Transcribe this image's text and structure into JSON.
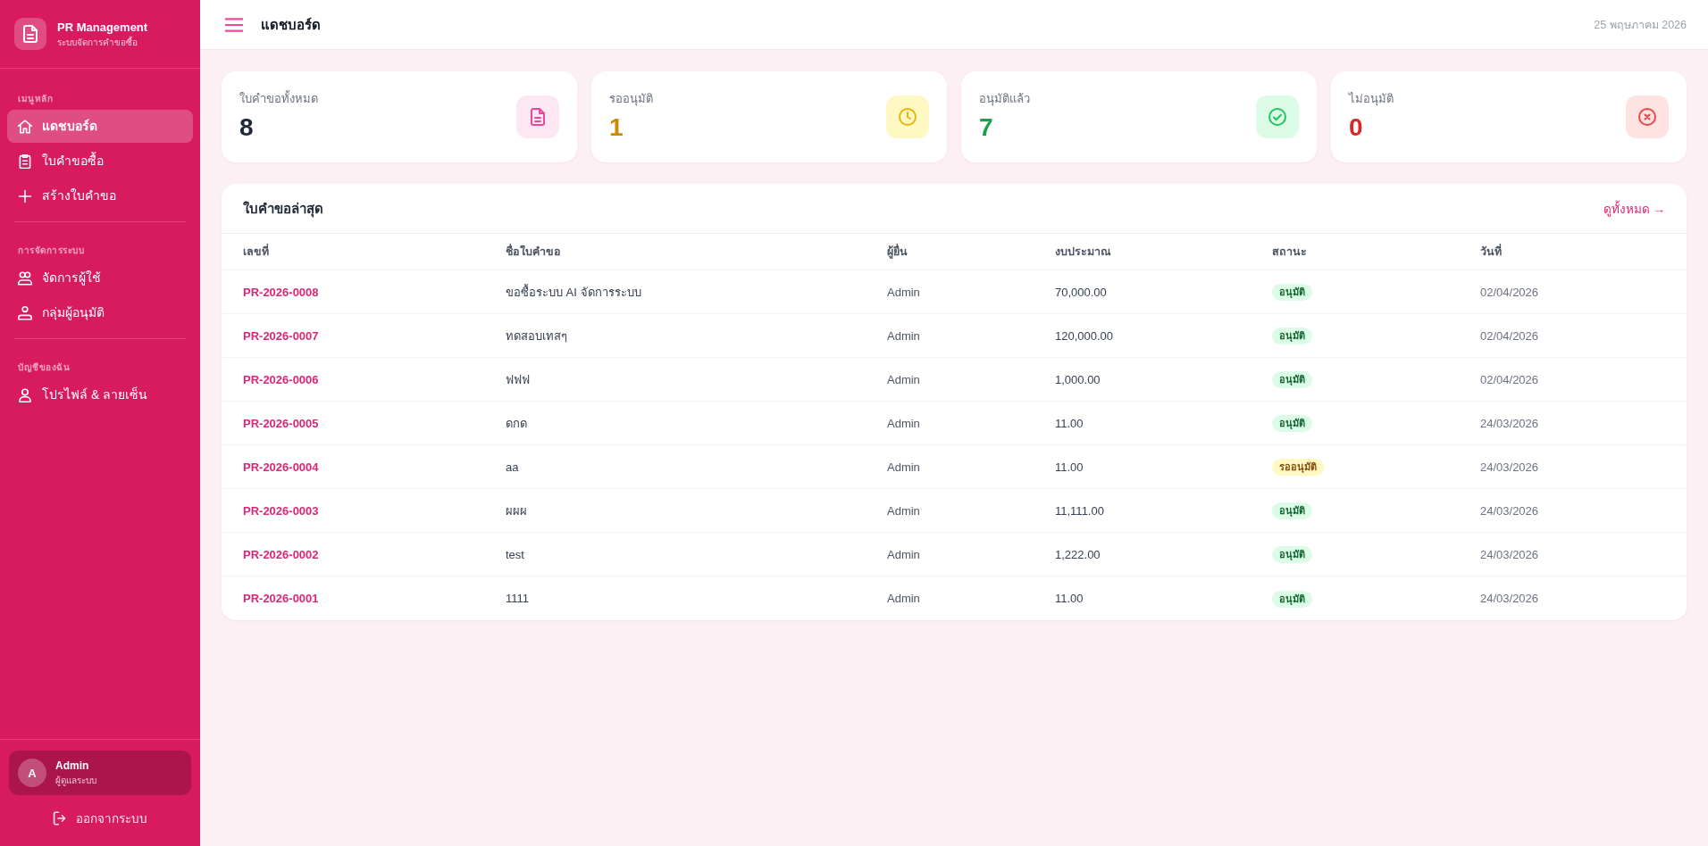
{
  "sidebar": {
    "brand": {
      "title": "PR Management",
      "subtitle": "ระบบจัดการคำขอซื้อ"
    },
    "sections": [
      {
        "label": "เมนูหลัก",
        "items": [
          {
            "label": "แดชบอร์ด",
            "selected": true
          },
          {
            "label": "ใบคำขอซื้อ",
            "selected": false
          },
          {
            "label": "สร้างใบคำขอ",
            "selected": false
          }
        ]
      },
      {
        "label": "การจัดการระบบ",
        "items": [
          {
            "label": "จัดการผู้ใช้",
            "selected": false
          },
          {
            "label": "กลุ่มผู้อนุมัติ",
            "selected": false
          }
        ]
      },
      {
        "label": "บัญชีของฉัน",
        "items": [
          {
            "label": "โปรไฟล์ & ลายเซ็น",
            "selected": false
          }
        ]
      }
    ],
    "user": {
      "initial": "A",
      "name": "Admin",
      "role": "ผู้ดูแลระบบ"
    },
    "logout": "ออกจากระบบ"
  },
  "header": {
    "title": "แดชบอร์ด",
    "date": "25 พฤษภาคม 2026"
  },
  "stats": [
    {
      "kind": "total",
      "label": "ใบคำขอทั้งหมด",
      "value": "8"
    },
    {
      "kind": "pending",
      "label": "รออนุมัติ",
      "value": "1"
    },
    {
      "kind": "approved",
      "label": "อนุมัติแล้ว",
      "value": "7"
    },
    {
      "kind": "rejected",
      "label": "ไม่อนุมัติ",
      "value": "0"
    }
  ],
  "recent": {
    "title": "ใบคำขอล่าสุด",
    "view_all": "ดูทั้งหมด →",
    "columns": [
      "เลขที่",
      "ชื่อใบคำขอ",
      "ผู้ยื่น",
      "งบประมาณ",
      "สถานะ",
      "วันที่"
    ],
    "rows": [
      {
        "number": "PR-2026-0008",
        "title": "ขอซื้อระบบ AI จัดการระบบ",
        "requester": "Admin",
        "budget": "70,000.00",
        "status": {
          "label": "อนุมัติ",
          "kind": "approved"
        },
        "date": "02/04/2026"
      },
      {
        "number": "PR-2026-0007",
        "title": "ทดสอบเทสๆ",
        "requester": "Admin",
        "budget": "120,000.00",
        "status": {
          "label": "อนุมัติ",
          "kind": "approved"
        },
        "date": "02/04/2026"
      },
      {
        "number": "PR-2026-0006",
        "title": "ฟฟฟ",
        "requester": "Admin",
        "budget": "1,000.00",
        "status": {
          "label": "อนุมัติ",
          "kind": "approved"
        },
        "date": "02/04/2026"
      },
      {
        "number": "PR-2026-0005",
        "title": "ดกด",
        "requester": "Admin",
        "budget": "11.00",
        "status": {
          "label": "อนุมัติ",
          "kind": "approved"
        },
        "date": "24/03/2026"
      },
      {
        "number": "PR-2026-0004",
        "title": "aa",
        "requester": "Admin",
        "budget": "11.00",
        "status": {
          "label": "รออนุมัติ",
          "kind": "pending"
        },
        "date": "24/03/2026"
      },
      {
        "number": "PR-2026-0003",
        "title": "ผผผ",
        "requester": "Admin",
        "budget": "11,111.00",
        "status": {
          "label": "อนุมัติ",
          "kind": "approved"
        },
        "date": "24/03/2026"
      },
      {
        "number": "PR-2026-0002",
        "title": "test",
        "requester": "Admin",
        "budget": "1,222.00",
        "status": {
          "label": "อนุมัติ",
          "kind": "approved"
        },
        "date": "24/03/2026"
      },
      {
        "number": "PR-2026-0001",
        "title": "1111",
        "requester": "Admin",
        "budget": "11.00",
        "status": {
          "label": "อนุมัติ",
          "kind": "approved"
        },
        "date": "24/03/2026"
      }
    ]
  }
}
